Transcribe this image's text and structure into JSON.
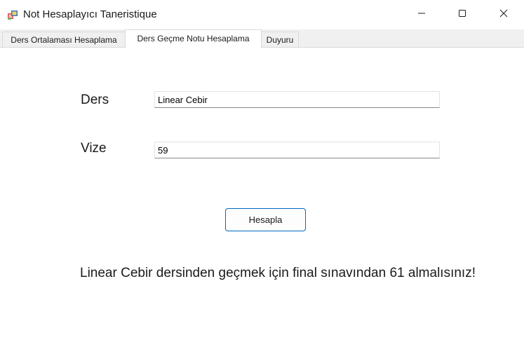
{
  "window": {
    "title": "Not Hesaplayıcı Taneristique",
    "icon": "windows-forms-app-icon",
    "controls": {
      "minimize": "minimize-icon",
      "maximize": "maximize-icon",
      "close": "close-icon"
    }
  },
  "tabs": [
    {
      "label": "Ders Ortalaması Hesaplama",
      "selected": false
    },
    {
      "label": "Ders Geçme Notu Hesaplama",
      "selected": true
    },
    {
      "label": "Duyuru",
      "selected": false
    }
  ],
  "form": {
    "ders_label": "Ders",
    "ders_value": "Linear Cebir",
    "vize_label": "Vize",
    "vize_value": "59",
    "calculate_label": "Hesapla",
    "result_text": "Linear Cebir dersinden geçmek için final sınavından 61 almalısınız!"
  },
  "colors": {
    "button_border": "#0067c0",
    "window_bg": "#f0f0f0",
    "page_bg": "#ffffff"
  }
}
